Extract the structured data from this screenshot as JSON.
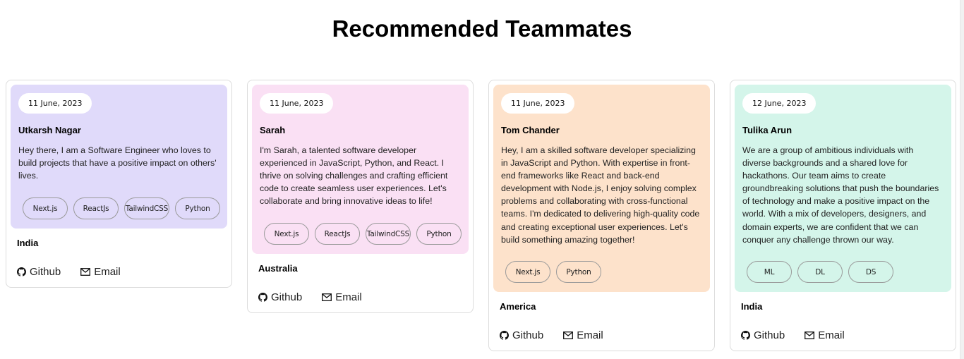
{
  "page": {
    "title": "Recommended Teammates"
  },
  "colors": {
    "card1": "#e0dafa",
    "card2": "#fae0f4",
    "card3": "#fde2cb",
    "card4": "#d4f5ea"
  },
  "cards": [
    {
      "date": "11 June, 2023",
      "name": "Utkarsh Nagar",
      "bio": "Hey there, I am a Software Engineer who loves to build projects that have a positive impact on others' lives.",
      "tags": [
        "Next.js",
        "ReactJs",
        "TailwindCSS",
        "Python"
      ],
      "location": "India",
      "github_label": "Github",
      "email_label": "Email"
    },
    {
      "date": "11 June, 2023",
      "name": "Sarah",
      "bio": "I'm Sarah, a talented software developer experienced in JavaScript, Python, and React. I thrive on solving challenges and crafting efficient code to create seamless user experiences. Let's collaborate and bring innovative ideas to life!",
      "tags": [
        "Next.js",
        "ReactJs",
        "TailwindCSS",
        "Python"
      ],
      "location": "Australia",
      "github_label": "Github",
      "email_label": "Email"
    },
    {
      "date": "11 June, 2023",
      "name": "Tom Chander",
      "bio": "Hey, I am a skilled software developer specializing in JavaScript and Python. With expertise in front-end frameworks like React and back-end development with Node.js, I enjoy solving complex problems and collaborating with cross-functional teams. I'm dedicated to delivering high-quality code and creating exceptional user experiences. Let's build something amazing together!",
      "tags": [
        "Next.js",
        "Python"
      ],
      "location": "America",
      "github_label": "Github",
      "email_label": "Email"
    },
    {
      "date": "12 June, 2023",
      "name": "Tulika Arun",
      "bio": "We are a group of ambitious individuals with diverse backgrounds and a shared love for hackathons. Our team aims to create groundbreaking solutions that push the boundaries of technology and make a positive impact on the world. With a mix of developers, designers, and domain experts, we are confident that we can conquer any challenge thrown our way.",
      "tags": [
        "ML",
        "DL",
        "DS"
      ],
      "location": "India",
      "github_label": "Github",
      "email_label": "Email"
    }
  ]
}
